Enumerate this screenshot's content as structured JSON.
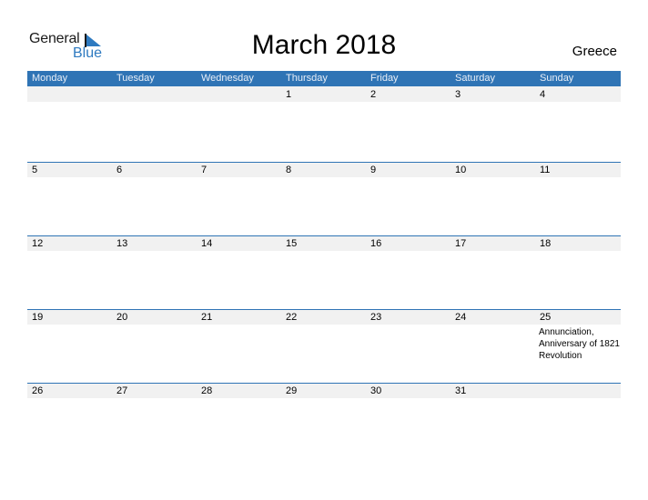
{
  "logo": {
    "general": "General",
    "blue": "Blue"
  },
  "title": "March 2018",
  "country": "Greece",
  "weekdays": [
    "Monday",
    "Tuesday",
    "Wednesday",
    "Thursday",
    "Friday",
    "Saturday",
    "Sunday"
  ],
  "weeks": [
    [
      {
        "day": ""
      },
      {
        "day": ""
      },
      {
        "day": ""
      },
      {
        "day": "1"
      },
      {
        "day": "2"
      },
      {
        "day": "3"
      },
      {
        "day": "4"
      }
    ],
    [
      {
        "day": "5"
      },
      {
        "day": "6"
      },
      {
        "day": "7"
      },
      {
        "day": "8"
      },
      {
        "day": "9"
      },
      {
        "day": "10"
      },
      {
        "day": "11"
      }
    ],
    [
      {
        "day": "12"
      },
      {
        "day": "13"
      },
      {
        "day": "14"
      },
      {
        "day": "15"
      },
      {
        "day": "16"
      },
      {
        "day": "17"
      },
      {
        "day": "18"
      }
    ],
    [
      {
        "day": "19"
      },
      {
        "day": "20"
      },
      {
        "day": "21"
      },
      {
        "day": "22"
      },
      {
        "day": "23"
      },
      {
        "day": "24"
      },
      {
        "day": "25",
        "event": "Annunciation, Anniversary of 1821 Revolution"
      }
    ],
    [
      {
        "day": "26"
      },
      {
        "day": "27"
      },
      {
        "day": "28"
      },
      {
        "day": "29"
      },
      {
        "day": "30"
      },
      {
        "day": "31"
      },
      {
        "day": ""
      }
    ]
  ],
  "colors": {
    "header": "#2f74b5",
    "strip": "#f1f1f1",
    "brand_blue": "#2e7ac0"
  }
}
